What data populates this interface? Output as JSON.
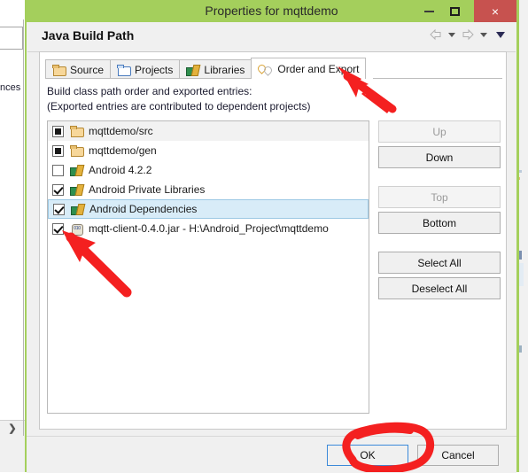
{
  "background": {
    "left_label": "nces",
    "scroll_arrow": "❯"
  },
  "window": {
    "title": "Properties for mqttdemo",
    "titlebar_color": "#a4cf5c",
    "close_color": "#c7524f",
    "minimize_label": "Minimize",
    "maximize_label": "Maximize",
    "close_label": "×"
  },
  "header": {
    "page_title": "Java Build Path",
    "nav": {
      "back": "back-arrow",
      "back_menu": "back-dropdown",
      "forward": "forward-arrow",
      "forward_menu": "forward-dropdown",
      "more": "more-dropdown"
    }
  },
  "tabs": [
    {
      "label": "Source",
      "icon": "source-folder-icon",
      "active": false
    },
    {
      "label": "Projects",
      "icon": "projects-folder-icon",
      "active": false
    },
    {
      "label": "Libraries",
      "icon": "libraries-icon",
      "active": false
    },
    {
      "label": "Order and Export",
      "icon": "order-export-icon",
      "active": true
    }
  ],
  "instructions": {
    "line1": "Build class path order and exported entries:",
    "line2": "(Exported entries are contributed to dependent projects)"
  },
  "entries": [
    {
      "label": "mqttdemo/src",
      "icon": "source-folder-icon",
      "check": "filled",
      "state": "hover"
    },
    {
      "label": "mqttdemo/gen",
      "icon": "source-folder-icon",
      "check": "filled",
      "state": "normal"
    },
    {
      "label": "Android 4.2.2",
      "icon": "library-icon",
      "check": "unchecked",
      "state": "normal"
    },
    {
      "label": "Android Private Libraries",
      "icon": "library-icon",
      "check": "checked",
      "state": "normal"
    },
    {
      "label": "Android Dependencies",
      "icon": "library-icon",
      "check": "checked",
      "state": "selected"
    },
    {
      "label": "mqtt-client-0.4.0.jar - H:\\Android_Project\\mqttdemo",
      "icon": "jar-icon",
      "check": "checked",
      "state": "normal"
    }
  ],
  "side_buttons": [
    {
      "label": "Up",
      "enabled": false,
      "gap_after": false
    },
    {
      "label": "Down",
      "enabled": true,
      "gap_after": true
    },
    {
      "label": "Top",
      "enabled": false,
      "gap_after": false
    },
    {
      "label": "Bottom",
      "enabled": true,
      "gap_after": true
    },
    {
      "label": "Select All",
      "enabled": true,
      "gap_after": false
    },
    {
      "label": "Deselect All",
      "enabled": true,
      "gap_after": false
    }
  ],
  "footer": {
    "ok_label": "OK",
    "cancel_label": "Cancel"
  },
  "annotations": {
    "color": "#f42020",
    "arrow_tab": "red-arrow-pointing-to-order-and-export-tab",
    "arrow_checkbox": "red-arrow-pointing-to-jar-checkbox",
    "circle_ok": "red-ellipse-around-ok-button"
  }
}
